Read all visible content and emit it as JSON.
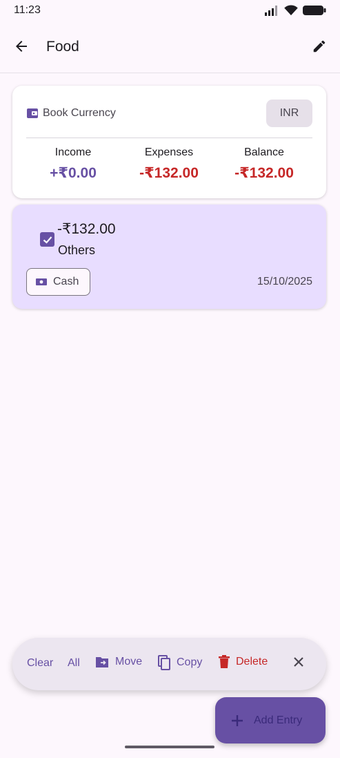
{
  "status_bar": {
    "time": "11:23"
  },
  "app_bar": {
    "title": "Food"
  },
  "summary": {
    "currency_label": "Book Currency",
    "currency_code": "INR",
    "income_label": "Income",
    "income_value": "+₹0.00",
    "expenses_label": "Expenses",
    "expenses_value": "-₹132.00",
    "balance_label": "Balance",
    "balance_value": "-₹132.00"
  },
  "entries": [
    {
      "amount": "-₹132.00",
      "category": "Others",
      "payment_mode": "Cash",
      "date": "15/10/2025",
      "selected": true
    }
  ],
  "selection_bar": {
    "clear_label": "Clear",
    "all_label": "All",
    "move_label": "Move",
    "copy_label": "Copy",
    "delete_label": "Delete"
  },
  "fab": {
    "label": "Add Entry"
  },
  "colors": {
    "primary": "#6750a4",
    "negative": "#c62828",
    "selected_card": "#e8ddff",
    "background": "#fdf7fd"
  },
  "icons": [
    "signal-icon",
    "wifi-icon",
    "battery-icon",
    "back-arrow-icon",
    "edit-pencil-icon",
    "wallet-icon",
    "checkbox-icon",
    "cash-icon",
    "move-folder-icon",
    "copy-icon",
    "delete-icon",
    "close-icon",
    "add-icon"
  ]
}
